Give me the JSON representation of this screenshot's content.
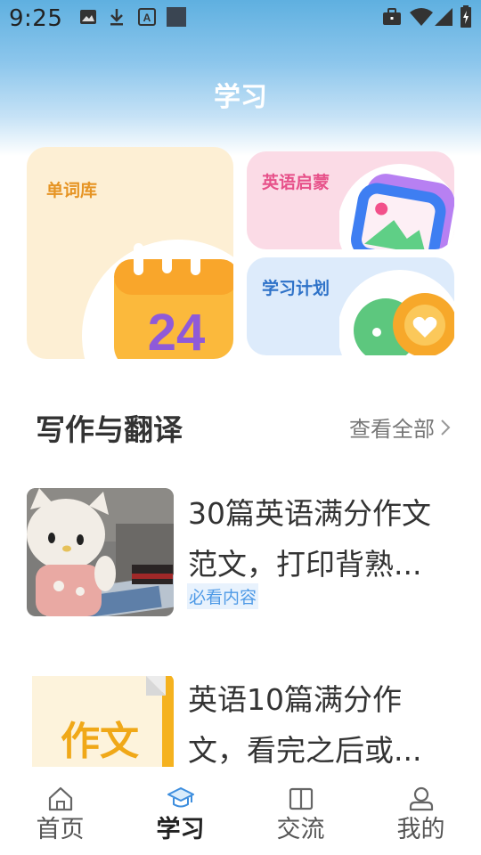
{
  "status_bar": {
    "time": "9:25"
  },
  "header": {
    "title": "学习"
  },
  "cards": {
    "vocab": {
      "label": "单词库",
      "calendar_number": "24"
    },
    "enlightenment": {
      "label": "英语启蒙"
    },
    "study_plan": {
      "label": "学习计划"
    }
  },
  "section": {
    "title": "写作与翻译",
    "view_all": "查看全部"
  },
  "articles": [
    {
      "title_line1": "30篇英语满分作文",
      "title_line2": "范文，打印背熟...",
      "tag": "必看内容"
    },
    {
      "title_line1": "英语10篇满分作",
      "title_line2": "文，看完之后或...",
      "thumb_text": "作文"
    }
  ],
  "bottom_nav": {
    "items": [
      {
        "label": "首页",
        "icon": "home-icon"
      },
      {
        "label": "学习",
        "icon": "graduation-cap-icon",
        "active": true
      },
      {
        "label": "交流",
        "icon": "book-icon"
      },
      {
        "label": "我的",
        "icon": "user-icon"
      }
    ]
  },
  "colors": {
    "header_gradient_top": "#5fb0e0",
    "vocab_bg": "#fdefd4",
    "enlight_bg": "#fbdbe6",
    "plan_bg": "#ddebfb",
    "tag_color": "#4f9ae6"
  }
}
